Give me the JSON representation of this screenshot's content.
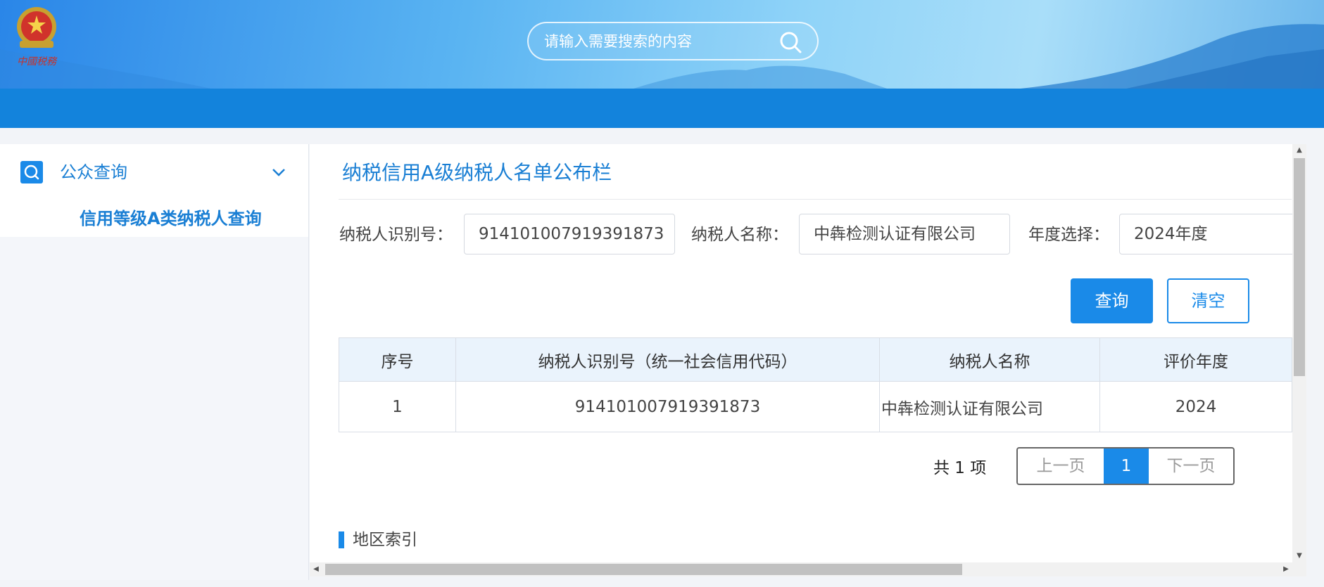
{
  "header": {
    "search_placeholder": "请输入需要搜索的内容"
  },
  "sidebar": {
    "title": "公众查询",
    "sub_item": "信用等级A类纳税人查询"
  },
  "main": {
    "title": "纳税信用A级纳税人名单公布栏",
    "form": {
      "taxpayer_id_label": "纳税人识别号：",
      "taxpayer_id_value": "914101007919391873",
      "taxpayer_name_label": "纳税人名称：",
      "taxpayer_name_value": "中犇检测认证有限公司",
      "year_label": "年度选择：",
      "year_value": "2024年度"
    },
    "buttons": {
      "query": "查询",
      "clear": "清空"
    },
    "table": {
      "headers": [
        "序号",
        "纳税人识别号（统一社会信用代码）",
        "纳税人名称",
        "评价年度"
      ],
      "rows": [
        [
          "1",
          "914101007919391873",
          "中犇检测认证有限公司",
          "2024"
        ]
      ]
    },
    "pagination": {
      "total": "共 1 项",
      "prev": "上一页",
      "current": "1",
      "next": "下一页"
    },
    "region_index": "地区索引"
  },
  "colors": {
    "primary": "#1a8ae8",
    "navbar": "#1383dc",
    "title_blue": "#1a7fd4"
  }
}
